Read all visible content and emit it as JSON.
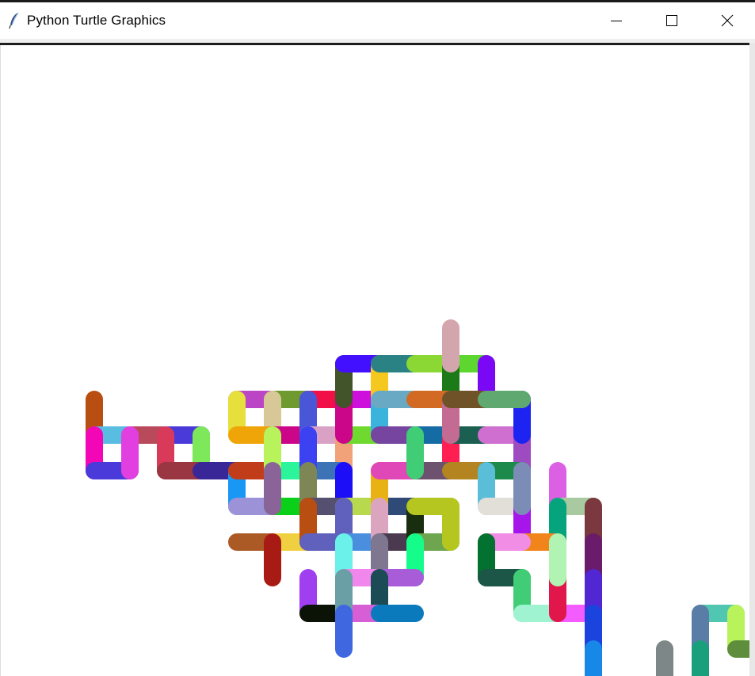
{
  "window": {
    "title": "Python Turtle Graphics",
    "icon": "feather-icon",
    "controls": [
      "minimize-icon",
      "maximize-icon",
      "close-icon"
    ]
  },
  "canvas": {
    "background": "#ffffff",
    "stroke_colors": [
      "#b84e12",
      "#58bde0",
      "#b84a5c",
      "#4a3ad9",
      "#e23fe0",
      "#f206b5",
      "#3c41f2",
      "#7ce85a",
      "#da3a5a",
      "#9a3542",
      "#3a2797",
      "#bb45c4",
      "#6e9a2f",
      "#f20f47",
      "#cd10dc",
      "#de39f0",
      "#e6df3c",
      "#d9c897",
      "#efa508",
      "#cb0688",
      "#4a56d8",
      "#d9a2c4",
      "#f1a278",
      "#6fd930",
      "#3ab3dd",
      "#7545a0",
      "#156ca4",
      "#ff1f53",
      "#1b5f50",
      "#cf70d0",
      "#9e4bc2",
      "#1d24f1",
      "#42542a",
      "#420fff",
      "#f5c820",
      "#2a8285",
      "#8bd835",
      "#1c7a19",
      "#5ed630",
      "#7b08f4",
      "#6aa9c3",
      "#d26a24",
      "#c36b92",
      "#6f5228",
      "#5fa86f",
      "#d3a6ad",
      "#1897f5",
      "#9c92d8",
      "#0bd019",
      "#c13d1a",
      "#2cf49b",
      "#8a6498",
      "#3b73b6",
      "#7e8656",
      "#1c0ef6",
      "#55506f",
      "#b8d84e",
      "#2f4a76",
      "#e8b214",
      "#e048b8",
      "#6c526e",
      "#b38420",
      "#1c8a4a",
      "#5abed9",
      "#e2dfd8",
      "#a615e9",
      "#7b8cb7",
      "#dc60e4",
      "#a9c9a1",
      "#7b383e",
      "#05a47d",
      "#f1841b",
      "#f18de5",
      "#ac2fa2",
      "#03712f",
      "#1b5646",
      "#40cd75",
      "#9ff3d1",
      "#f35cff",
      "#e1174b",
      "#b1f3b3",
      "#6a1c6a",
      "#5126d3",
      "#1b43de",
      "#1787e8",
      "#7d8787",
      "#51c6b0",
      "#b8f35b",
      "#5a7da7",
      "#1a9f7d",
      "#5e8e3b",
      "#a81b15",
      "#a03ff0",
      "#0b1206",
      "#d65fd6",
      "#3e67e0",
      "#6b9fa6",
      "#f187ed",
      "#7e778f",
      "#a95cd8",
      "#1b4b54",
      "#0b7abc",
      "#6060bd",
      "#6bf1ea",
      "#4a8fdd",
      "#dca5bf",
      "#4b3a4f",
      "#15fc8a",
      "#182e0e",
      "#6ea64f",
      "#b5c621",
      "#772ea5",
      "#f0d040",
      "#ab5925"
    ]
  }
}
